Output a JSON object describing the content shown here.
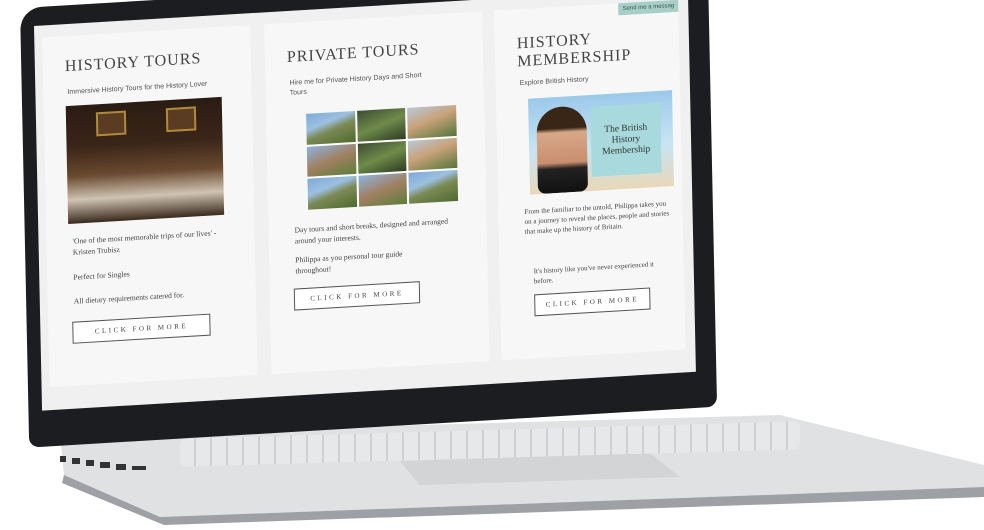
{
  "panels": {
    "history_tours": {
      "title": "HISTORY TOURS",
      "subtitle": "Immersive History Tours for the History Lover",
      "quote": "'One of the most memorable trips of our lives' - Kristen Trubisz",
      "line1": "Perfect for Singles",
      "line2": "All dietary requirements catered for.",
      "button": "CLICK FOR MORE"
    },
    "private_tours": {
      "title": "PRIVATE TOURS",
      "subtitle": "Hire me for Private History Days and Short Tours",
      "body1": "Day tours and short breaks, designed and arranged around your interests.",
      "body2": "Philippa as you personal tour guide throughout!",
      "button": "CLICK FOR MORE"
    },
    "history_membership": {
      "title": "HISTORY MEMBERSHIP",
      "subtitle": "Explore British History",
      "image_text": "The British History Membership",
      "body1": "From the familiar to the untold, Philippa takes you on a journey to reveal the places, people and stories that make up the history of Britain.",
      "body2": "It's history like you've never experienced it before.",
      "button": "CLICK FOR MORE",
      "send_message": "Send me a messag"
    }
  },
  "icons": {
    "message": "chat-tab"
  }
}
